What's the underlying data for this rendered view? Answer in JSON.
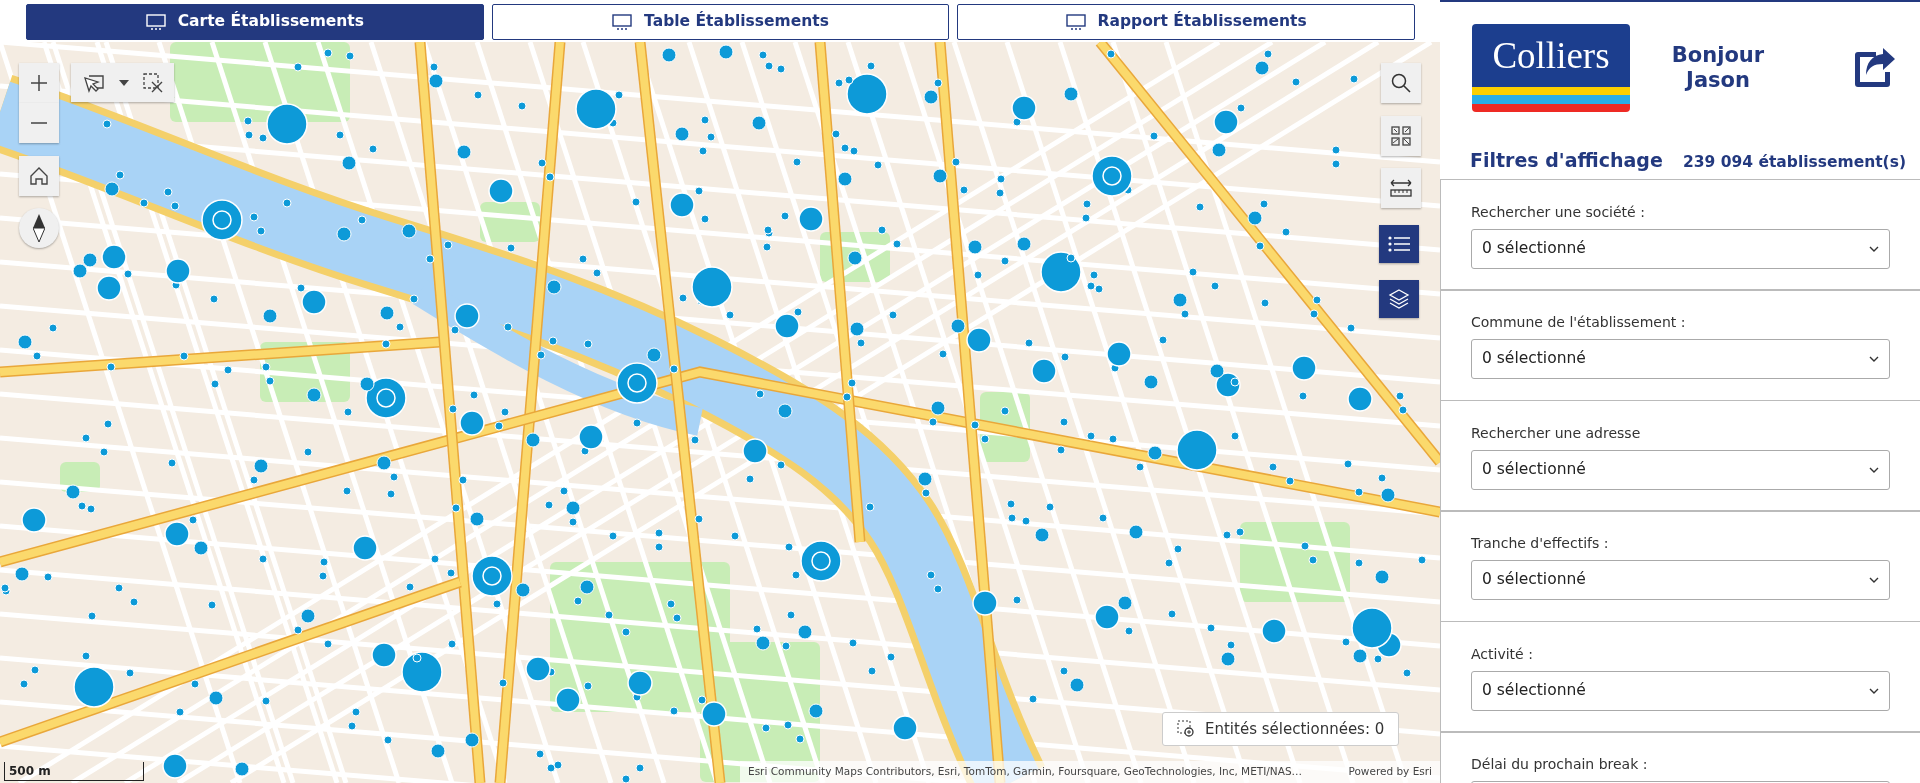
{
  "tabs": [
    {
      "label": "Carte Établissements",
      "selected": true
    },
    {
      "label": "Table Établissements",
      "selected": false
    },
    {
      "label": "Rapport Établissements",
      "selected": false
    }
  ],
  "map": {
    "selection_count": "Entités sélectionnées: 0",
    "scale": "500 m",
    "attribution": "Esri Community Maps Contributors, Esri, TomTom, Garmin, Foursquare, GeoTechnologies, Inc, METI/NAS…",
    "powered_by": "Powered by Esri"
  },
  "header": {
    "logo": "Colliers",
    "greeting": "Bonjour Jason"
  },
  "filters_title": "Filtres d'affichage",
  "count": "239 094 établissement(s)",
  "filters": [
    {
      "label": "Rechercher une société :",
      "value": "0 sélectionné"
    },
    {
      "label": "Commune de l'établissement :",
      "value": "0 sélectionné"
    },
    {
      "label": "Rechercher une adresse",
      "value": "0 sélectionné"
    },
    {
      "label": "Tranche d'effectifs :",
      "value": "0 sélectionné"
    },
    {
      "label": "Activité :",
      "value": "0 sélectionné"
    },
    {
      "label": "Délai du prochain break :"
    }
  ]
}
